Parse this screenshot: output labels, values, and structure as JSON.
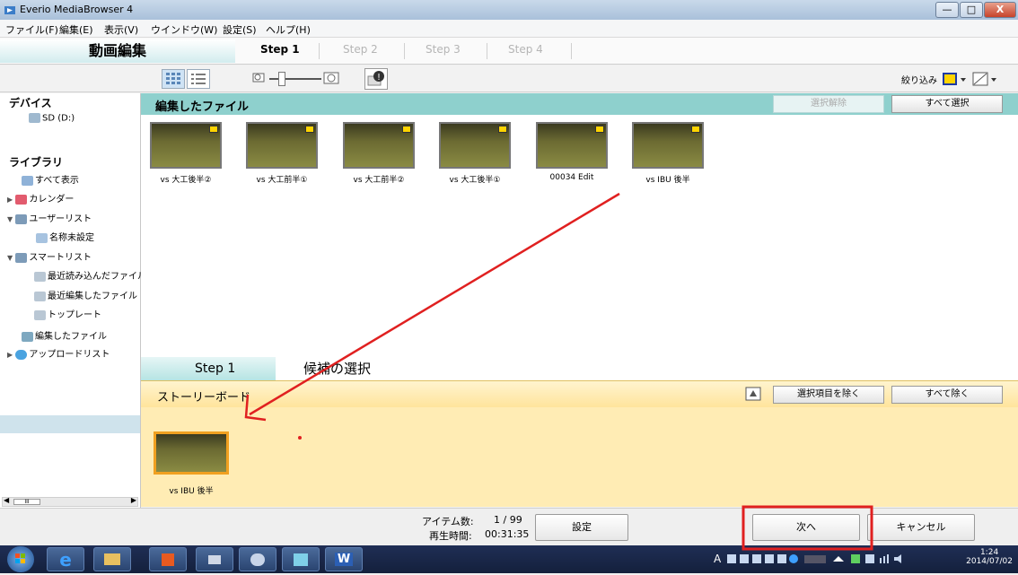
{
  "window": {
    "title": "Everio MediaBrowser 4",
    "minimize": "—",
    "maximize": "□",
    "close": "X"
  },
  "menu": [
    "ファイル(F)",
    "編集(E)",
    "表示(V)",
    "ウインドウ(W)",
    "設定(S)",
    "ヘルプ(H)"
  ],
  "stepbar": {
    "mode": "動画編集",
    "steps": [
      "Step 1",
      "Step 2",
      "Step 3",
      "Step 4"
    ]
  },
  "toolbar": {
    "filter_label": "絞り込み"
  },
  "sidebar": {
    "devices_heading": "デバイス",
    "device": "SD (D:)",
    "library_heading": "ライブラリ",
    "items": [
      "すべて表示",
      "カレンダー",
      "ユーザーリスト",
      "名称未設定",
      "スマートリスト",
      "最近読み込んだファイル",
      "最近編集したファイル",
      "トップレート",
      "編集したファイル",
      "アップロードリスト"
    ],
    "scroll_thumb": "III"
  },
  "files": {
    "heading": "編集したファイル",
    "deselect_button": "選択解除",
    "select_all_button": "すべて選択",
    "thumbnails": [
      "vs 大工後半②",
      "vs 大工前半①",
      "vs 大工前半②",
      "vs 大工後半①",
      "00034 Edit",
      "vs IBU 後半"
    ]
  },
  "step1": {
    "tab": "Step 1",
    "title": "候補の選択"
  },
  "storyboard": {
    "heading": "ストーリーボード",
    "remove_selected_button": "選択項目を除く",
    "remove_all_button": "すべて除く",
    "items": [
      "vs IBU 後半"
    ]
  },
  "status": {
    "item_count_label": "アイテム数:",
    "item_count_value": "1 / 99",
    "duration_label": "再生時間:",
    "duration_value": "00:31:35",
    "settings_button": "設定",
    "next_button": "次へ",
    "cancel_button": "キャンセル"
  },
  "taskbar": {
    "word_icon": "W",
    "language": "A",
    "time": "1:24",
    "date": "2014/07/02"
  },
  "annotations": {
    "arrow_color": "#e02020",
    "highlight_color": "#e02020"
  }
}
